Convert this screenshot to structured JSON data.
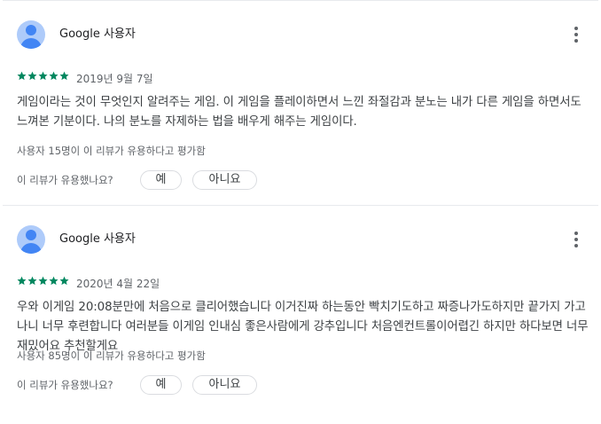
{
  "reviews": [
    {
      "author": "Google 사용자",
      "rating": 5,
      "date": "2019년 9월 7일",
      "text": "게임이라는 것이 무엇인지 알려주는 게임. 이 게임을 플레이하면서 느낀 좌절감과 분노는 내가 다른 게임을 하면서도 느껴본 기분이다. 나의 분노를 자제하는 법을 배우게 해주는 게임이다.",
      "helpful_count": "사용자 15명이 이 리뷰가 유용하다고 평가함",
      "helpful_question": "이 리뷰가 유용했나요?",
      "yes_label": "예",
      "no_label": "아니요"
    },
    {
      "author": "Google 사용자",
      "rating": 5,
      "date": "2020년 4월 22일",
      "text": "우와 이게임 20:08분만에 처음으로 클리어했습니다 이거진짜 하는동안 빡치기도하고 짜증나가도하지만 끝가지 가고나니 너무 후련합니다 여러분들 이게임 인내심 좋은사람에게 강추입니다 처음엔컨트롤이어렵긴 하지만 하다보면 너무재밌어요 추천할게요",
      "helpful_count": "사용자 85명이 이 리뷰가 유용하다고 평가함",
      "helpful_question": "이 리뷰가 유용했나요?",
      "yes_label": "예",
      "no_label": "아니요"
    }
  ],
  "colors": {
    "star": "#01875f",
    "avatar_bg": "#aecbfa",
    "avatar_fg": "#4285f4",
    "divider": "#e8eaed"
  },
  "icons": {
    "avatar": "user-avatar-icon",
    "more": "more-vert-icon",
    "star": "star-icon"
  }
}
